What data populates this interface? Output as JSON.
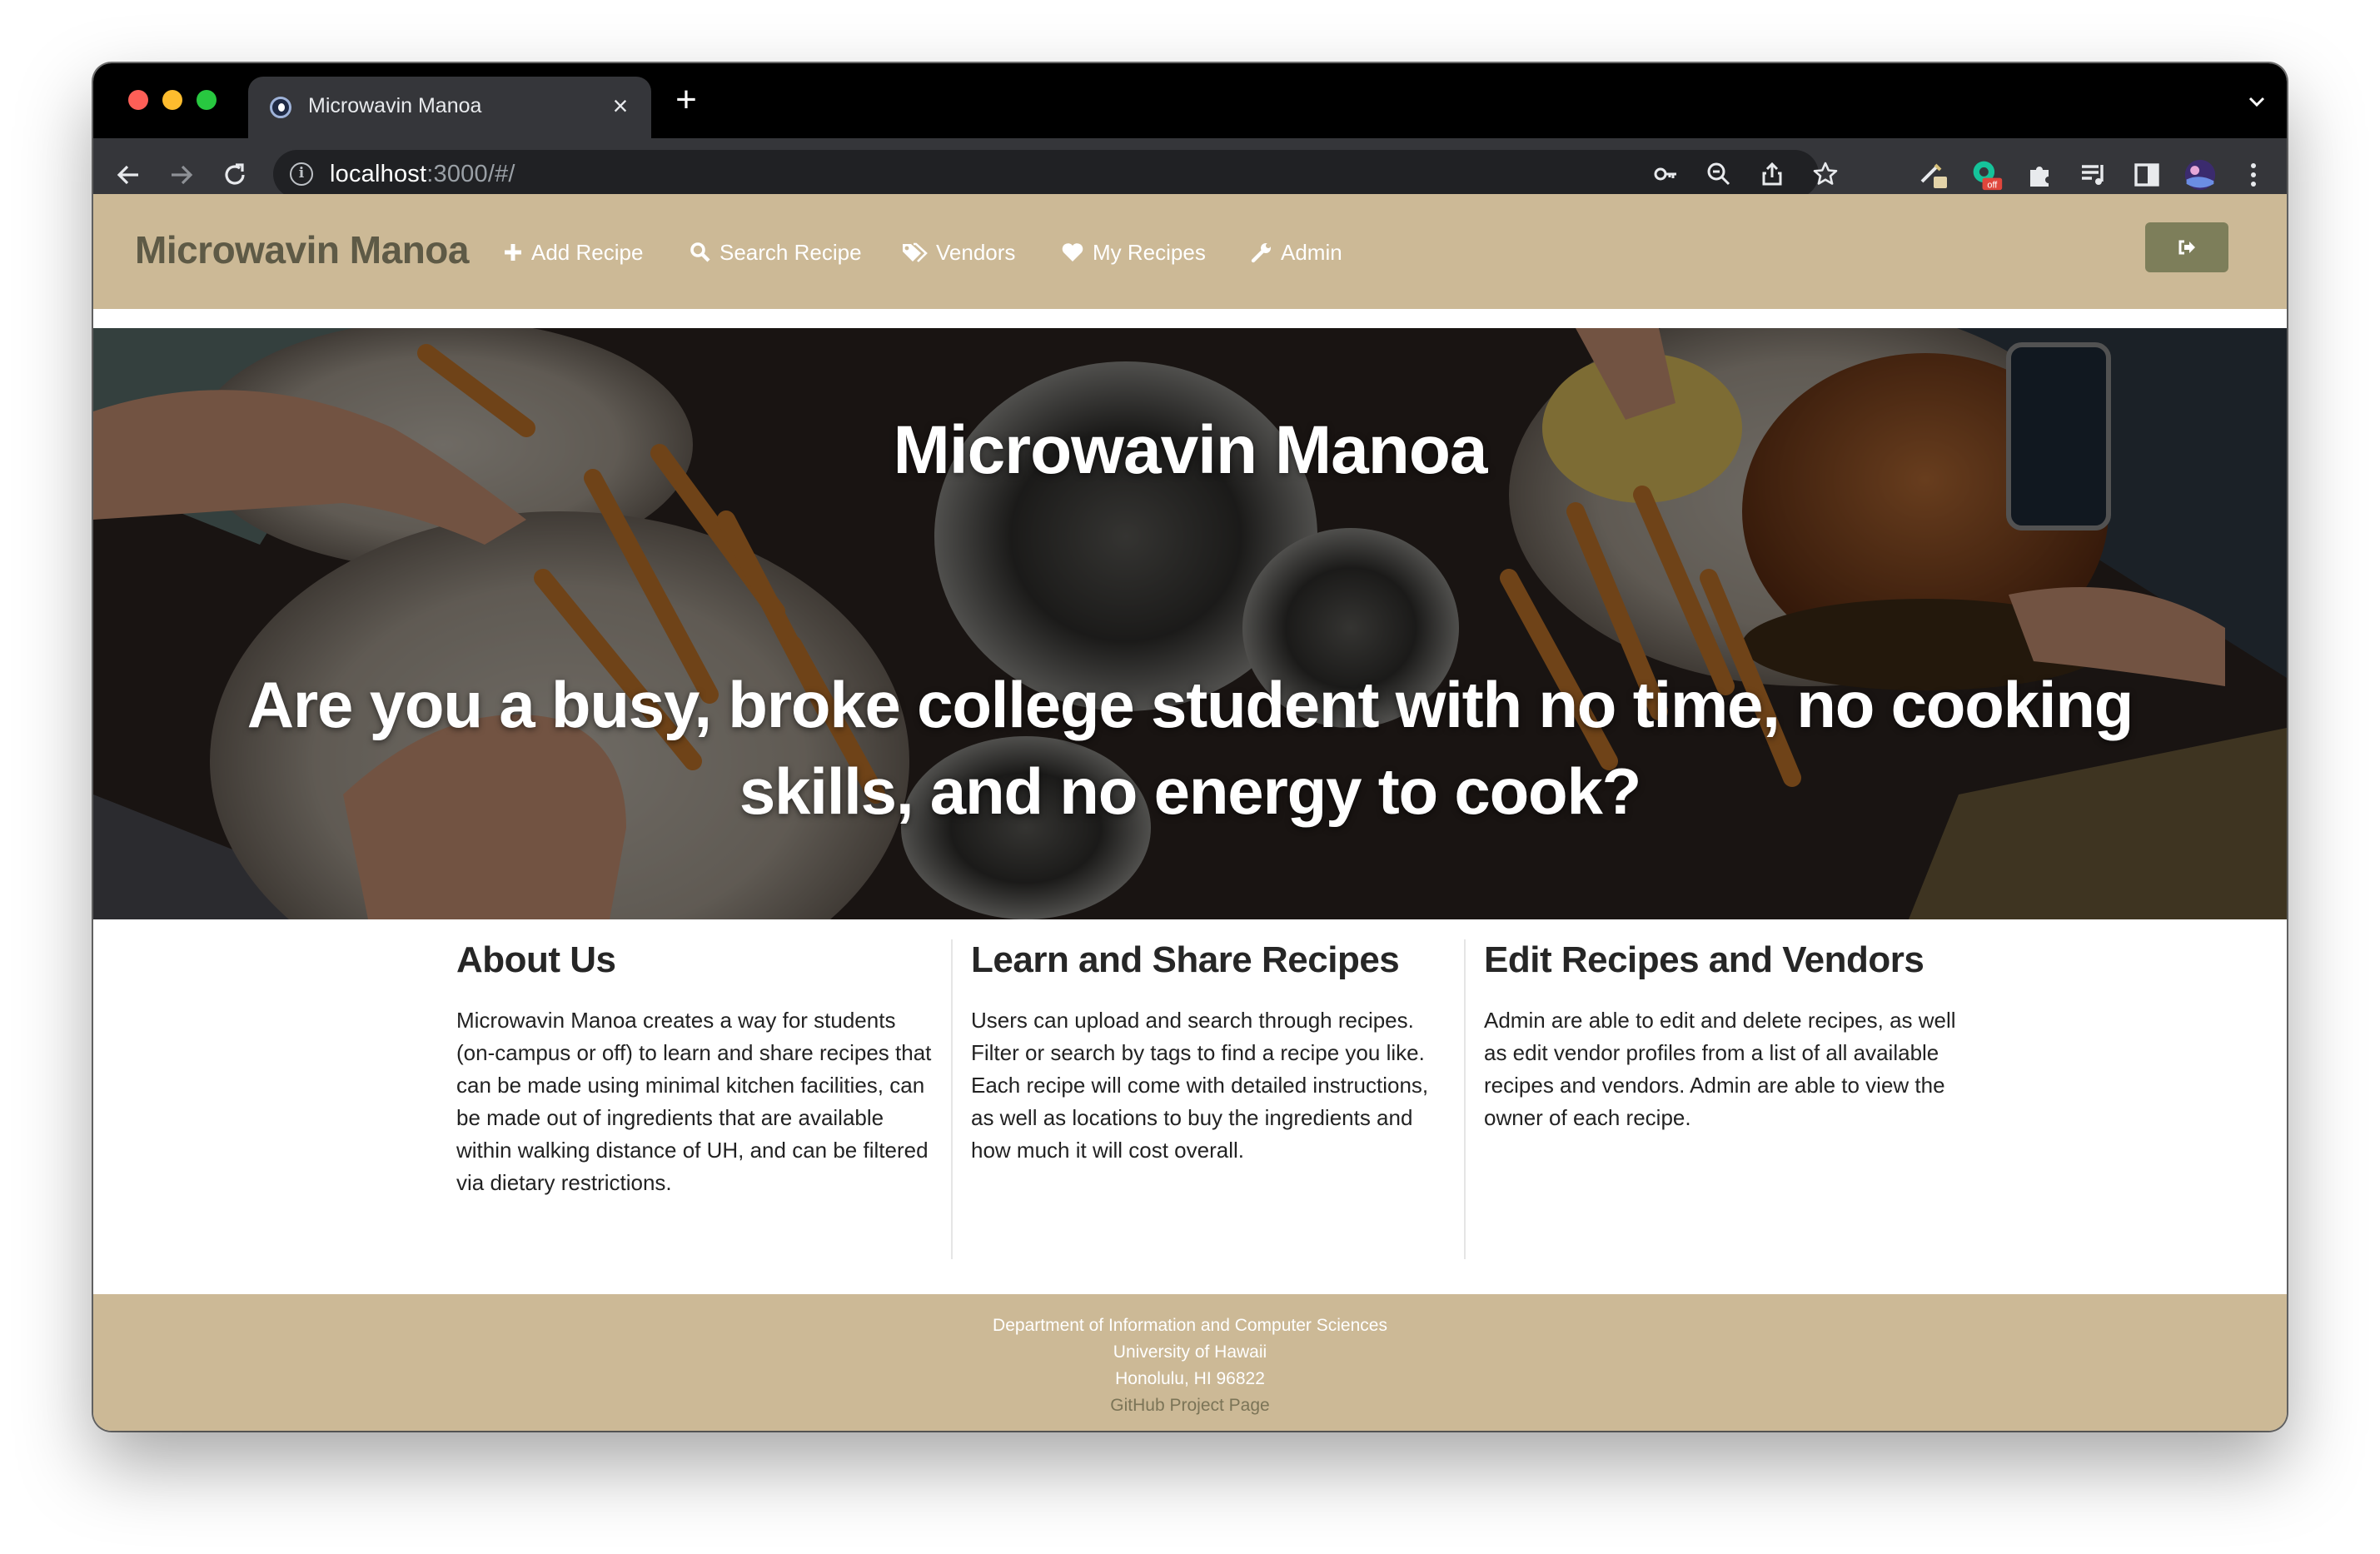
{
  "browser": {
    "tab_title": "Microwavin Manoa",
    "url_host": "localhost",
    "url_rest": ":3000/#/",
    "extension_badge": "off"
  },
  "navbar": {
    "brand": "Microwavin Manoa",
    "items": [
      {
        "label": "Add Recipe",
        "icon": "plus-icon"
      },
      {
        "label": "Search Recipe",
        "icon": "search-icon"
      },
      {
        "label": "Vendors",
        "icon": "tags-icon"
      },
      {
        "label": "My Recipes",
        "icon": "heart-icon"
      },
      {
        "label": "Admin",
        "icon": "wrench-icon"
      }
    ],
    "logout_icon": "sign-out-icon"
  },
  "hero": {
    "title": "Microwavin Manoa",
    "tagline": "Are you a busy, broke college student with no time, no cooking skills, and no energy to cook?"
  },
  "features": [
    {
      "heading": "About Us",
      "body": "Microwavin Manoa creates a way for students (on-campus or off) to learn and share recipes that can be made using minimal kitchen facilities, can be made out of ingredients that are available within walking distance of UH, and can be filtered via dietary restrictions."
    },
    {
      "heading": "Learn and Share Recipes",
      "body": "Users can upload and search through recipes. Filter or search by tags to find a recipe you like. Each recipe will come with detailed instructions, as well as locations to buy the ingredients and how much it will cost overall."
    },
    {
      "heading": "Edit Recipes and Vendors",
      "body": "Admin are able to edit and delete recipes, as well as edit vendor profiles from a list of all available recipes and vendors. Admin are able to view the owner of each recipe."
    }
  ],
  "footer": {
    "line1": "Department of Information and Computer Sciences",
    "line2": "University of Hawaii",
    "line3": "Honolulu, HI 96822",
    "link": "GitHub Project Page"
  },
  "colors": {
    "navbar_bg": "#ccb996",
    "brand_text": "#5e5a46",
    "logout_button": "#7d7e5a",
    "footer_link": "#7b7457"
  }
}
